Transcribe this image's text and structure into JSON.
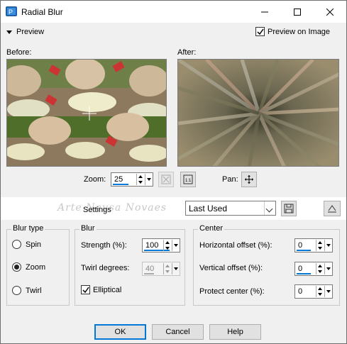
{
  "window": {
    "title": "Radial Blur",
    "preview_label": "Preview",
    "preview_on_image_label": "Preview on Image",
    "preview_on_image_checked": true
  },
  "preview": {
    "before_label": "Before:",
    "after_label": "After:",
    "zoom_label": "Zoom:",
    "zoom_value": "25",
    "pan_label": "Pan:"
  },
  "settings": {
    "label": "Settings",
    "preset_value": "Last Used",
    "watermark": "Arte Neusa Novaes"
  },
  "blur_type": {
    "title": "Blur type",
    "options": [
      "Spin",
      "Zoom",
      "Twirl"
    ],
    "selected": "Zoom"
  },
  "blur": {
    "title": "Blur",
    "strength_label": "Strength (%):",
    "strength_value": "100",
    "twirl_label": "Twirl degrees:",
    "twirl_value": "40",
    "elliptical_label": "Elliptical",
    "elliptical_checked": true
  },
  "center": {
    "title": "Center",
    "h_offset_label": "Horizontal offset (%):",
    "h_offset_value": "0",
    "v_offset_label": "Vertical offset (%):",
    "v_offset_value": "0",
    "protect_label": "Protect center (%):",
    "protect_value": "0"
  },
  "buttons": {
    "ok": "OK",
    "cancel": "Cancel",
    "help": "Help"
  },
  "colors": {
    "accent": "#0078d7",
    "dialog_bg": "#f0f0f0"
  }
}
